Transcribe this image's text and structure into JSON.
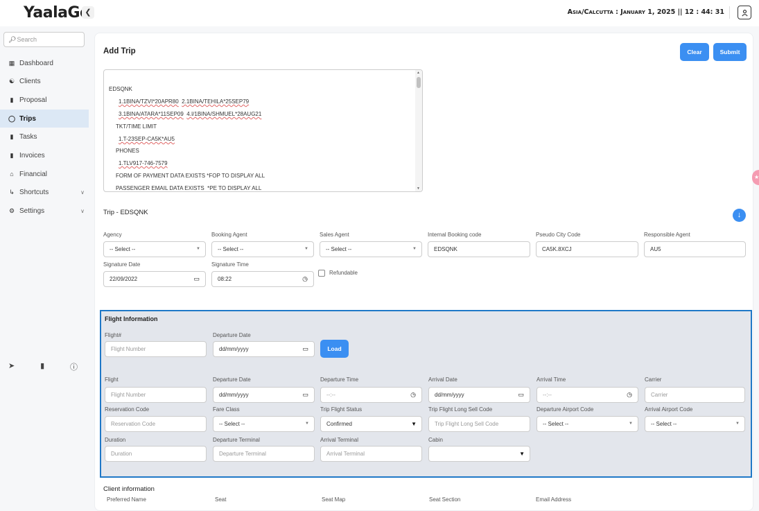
{
  "app": {
    "logo": "YaalaGo",
    "collapse_icon": "chevron-left"
  },
  "header": {
    "timezone_text": "Asia/Calcutta : January 1, 2025 || 12 : 44: 31",
    "user_icon": "user-icon"
  },
  "sidebar": {
    "search_placeholder": "Search",
    "items": [
      {
        "label": "Dashboard",
        "icon": "dashboard-icon"
      },
      {
        "label": "Clients",
        "icon": "globe-icon"
      },
      {
        "label": "Proposal",
        "icon": "document-icon"
      },
      {
        "label": "Trips",
        "icon": "circle-icon",
        "active": true
      },
      {
        "label": "Tasks",
        "icon": "task-icon"
      },
      {
        "label": "Invoices",
        "icon": "invoice-icon"
      },
      {
        "label": "Financial",
        "icon": "bank-icon"
      },
      {
        "label": "Shortcuts",
        "icon": "share-icon",
        "expandable": true
      },
      {
        "label": "Settings",
        "icon": "gear-icon",
        "expandable": true
      }
    ],
    "bottom_icons": [
      "rocket-icon",
      "file-icon",
      "help-icon"
    ]
  },
  "page": {
    "title": "Add Trip",
    "clear_label": "Clear",
    "submit_label": "Submit",
    "pnr": {
      "l1": "EDSQNK",
      "l2a": "1.1BINA/TZVI*20APR80",
      "l2b": "2.1BINA/TEHILA*25SEP79",
      "l3a": "3.1BINA/ATARA*11SEP09",
      "l3b": "4.I/1BINA/SHMUEL*28AUG21",
      "l4": "TKT/TIME LIMIT",
      "l5": "1.T-23SEP-CA5K*AU5",
      "l6": "PHONES",
      "l7": "1.TLV917-746-7579",
      "l8": "FORM OF PAYMENT DATA EXISTS *FOP TO DISPLAY ALL",
      "l9": "PASSENGER EMAIL DATA EXISTS  *PE TO DISPLAY ALL"
    },
    "trip_heading": "Trip - EDSQNK",
    "trip": {
      "agency_label": "Agency",
      "agency_value": "-- Select --",
      "booking_agent_label": "Booking Agent",
      "booking_agent_value": "-- Select --",
      "sales_agent_label": "Sales Agent",
      "sales_agent_value": "-- Select --",
      "internal_code_label": "Internal Booking code",
      "internal_code_value": "EDSQNK",
      "pcc_label": "Pseudo City Code",
      "pcc_value": "CA5K.8XCJ",
      "resp_agent_label": "Responsible Agent",
      "resp_agent_value": "AU5",
      "sig_date_label": "Signature Date",
      "sig_date_value": "22/09/2022",
      "sig_time_label": "Signature Time",
      "sig_time_value": "08:22",
      "refundable_label": "Refundable"
    },
    "flight_info": {
      "title": "Flight Information",
      "search_flight_label": "Flight#",
      "search_flight_ph": "Flight Number",
      "search_date_label": "Departure Date",
      "search_date_ph": "dd/mm/yyyy",
      "load_label": "Load",
      "flight_label": "Flight",
      "flight_ph": "Flight Number",
      "dep_date_label": "Departure Date",
      "dep_date_ph": "dd/mm/yyyy",
      "dep_time_label": "Departure Time",
      "dep_time_ph": "--:--",
      "arr_date_label": "Arrival Date",
      "arr_date_ph": "dd/mm/yyyy",
      "arr_time_label": "Arrival Time",
      "arr_time_ph": "--:--",
      "carrier_label": "Carrier",
      "carrier_ph": "Carrier",
      "res_code_label": "Reservation Code",
      "res_code_ph": "Reservation Code",
      "fare_class_label": "Fare Class",
      "fare_class_value": "-- Select --",
      "status_label": "Trip Flight Status",
      "status_value": "Confirmed",
      "long_sell_label": "Trip Flight Long Sell Code",
      "long_sell_ph": "Trip Flight Long Sell Code",
      "dep_airport_label": "Departure Airport Code",
      "dep_airport_value": "-- Select --",
      "arr_airport_label": "Arrival Airport Code",
      "arr_airport_value": "-- Select --",
      "duration_label": "Duration",
      "duration_ph": "Duration",
      "dep_terminal_label": "Departure Terminal",
      "dep_terminal_ph": "Departure Terminal",
      "arr_terminal_label": "Arrival Terminal",
      "arr_terminal_ph": "Arrival Terminal",
      "cabin_label": "Cabin",
      "cabin_value": ""
    },
    "client_info": {
      "title": "Client information",
      "columns": [
        "Preferred Name",
        "Seat",
        "Seat Map",
        "Seat Section",
        "Email Address"
      ]
    }
  }
}
